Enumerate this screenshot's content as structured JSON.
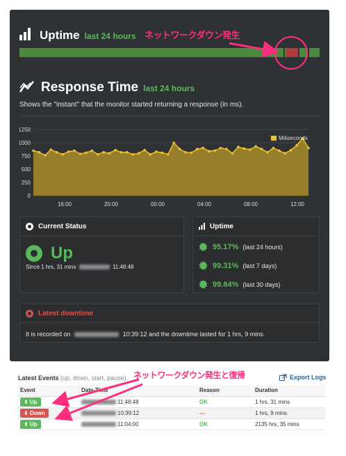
{
  "uptime_header": {
    "title": "Uptime",
    "subtitle": "last 24 hours"
  },
  "annotation_top": "ネットワークダウン発生",
  "annotation_events": "ネットワークダウン発生と復帰",
  "response_header": {
    "title": "Response Time",
    "subtitle": "last 24 hours"
  },
  "description": "Shows the \"instant\" that the monitor started returning a response (in ms).",
  "current_status": {
    "title": "Current Status",
    "status": "Up",
    "since_prefix": "Since 1 hrs, 31 mins",
    "since_time": "11:48:48"
  },
  "uptime_box": {
    "title": "Uptime",
    "rows": [
      {
        "pct": "95.17%",
        "label": "(last 24 hours)"
      },
      {
        "pct": "99.31%",
        "label": "(last 7 days)"
      },
      {
        "pct": "99.84%",
        "label": "(last 30 days)"
      }
    ]
  },
  "latest_downtime": {
    "title": "Latest downtime",
    "text_prefix": "It is recorded on",
    "text_suffix": "10:39:12 and the downtime lasted for 1 hrs, 9 mins."
  },
  "events": {
    "title": "Latest Events",
    "title_sub": "(up, down, start, pause)",
    "export_label": "Export Logs",
    "columns": [
      "Event",
      "Date-Time",
      "Reason",
      "Duration"
    ],
    "rows": [
      {
        "event": "Up",
        "type": "up",
        "time": "11:48:48",
        "reason": "OK",
        "duration": "1 hrs, 31 mins"
      },
      {
        "event": "Down",
        "type": "down",
        "time": "10:39:12",
        "reason": "---",
        "duration": "1 hrs, 9 mins"
      },
      {
        "event": "Up",
        "type": "up",
        "time": "11:04:00",
        "reason": "OK",
        "duration": "2135 hrs, 35 mins"
      }
    ]
  },
  "colors": {
    "green": "#5cb85c",
    "red": "#d9534f",
    "panel": "#2f3234",
    "line": "#f0c030",
    "annotation": "#ff2d7e"
  },
  "chart_data": {
    "type": "area",
    "legend": "Miliseconds",
    "legend_position": "top-right",
    "yticks": [
      "1250",
      "1000",
      "750",
      "500",
      "250",
      "0"
    ],
    "xticks": [
      "16:00",
      "20:00",
      "00:00",
      "04:00",
      "08:00",
      "12:00"
    ],
    "ylim": [
      0,
      1250
    ],
    "grid": true,
    "values": [
      850,
      820,
      760,
      870,
      820,
      780,
      830,
      850,
      790,
      810,
      850,
      780,
      820,
      800,
      860,
      820,
      820,
      780,
      800,
      860,
      780,
      830,
      810,
      780,
      1000,
      880,
      820,
      810,
      880,
      900,
      840,
      850,
      900,
      880,
      800,
      920,
      890,
      870,
      930,
      880,
      820,
      900,
      850,
      800,
      860,
      950,
      1080,
      900
    ]
  }
}
